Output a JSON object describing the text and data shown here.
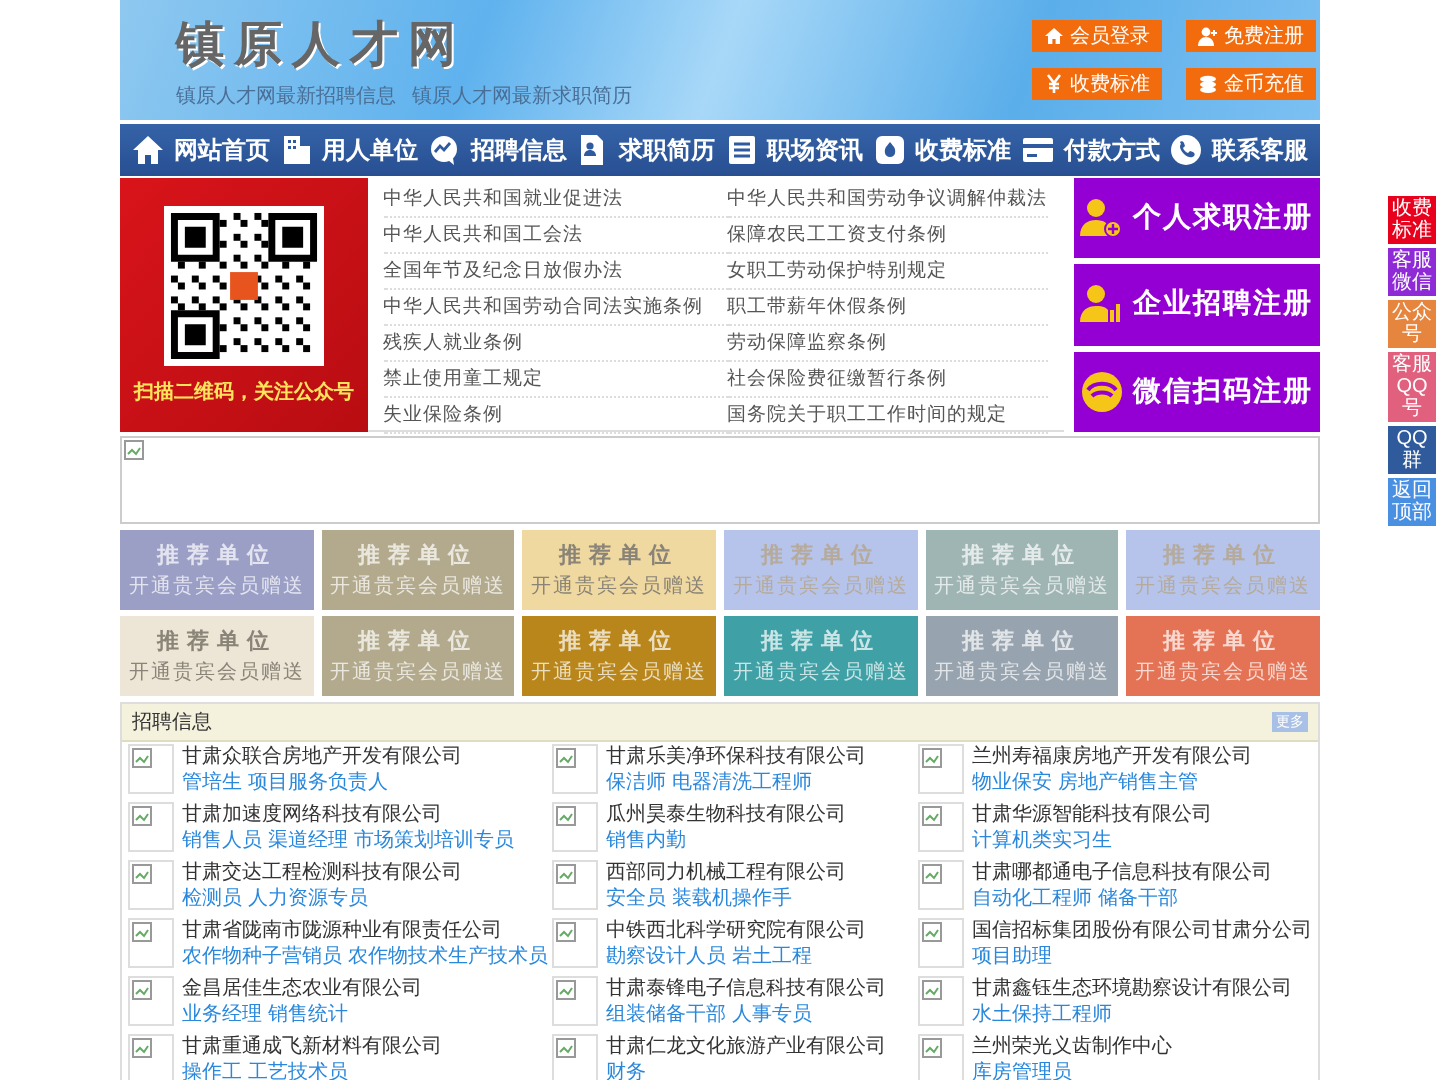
{
  "header": {
    "site_title": "镇原人才网",
    "taglines": [
      "镇原人才网最新招聘信息",
      "镇原人才网最新求职简历"
    ],
    "buttons": [
      "会员登录",
      "免费注册",
      "收费标准",
      "金币充值"
    ]
  },
  "nav": [
    "网站首页",
    "用人单位",
    "招聘信息",
    "求职简历",
    "职场资讯",
    "收费标准",
    "付款方式",
    "联系客服"
  ],
  "qr": {
    "caption": "扫描二维码，关注公众号"
  },
  "laws": [
    "中华人民共和国就业促进法",
    "中华人民共和国劳动争议调解仲裁法",
    "中华人民共和国工会法",
    "保障农民工工资支付条例",
    "全国年节及纪念日放假办法",
    "女职工劳动保护特别规定",
    "中华人民共和国劳动合同法实施条例",
    "职工带薪年休假条例",
    "残疾人就业条例",
    "劳动保障监察条例",
    "禁止使用童工规定",
    "社会保险费征缴暂行条例",
    "失业保险条例",
    "国务院关于职工工作时间的规定"
  ],
  "register_buttons": [
    "个人求职注册",
    "企业招聘注册",
    "微信扫码注册"
  ],
  "promo_tiles": [
    {
      "title": "推荐单位",
      "subtitle": "开通贵宾会员赠送",
      "color": "#9b9fc6"
    },
    {
      "title": "推荐单位",
      "subtitle": "开通贵宾会员赠送",
      "color": "#b3aa8e"
    },
    {
      "title": "推荐单位",
      "subtitle": "开通贵宾会员赠送",
      "color": "#f0d9a0"
    },
    {
      "title": "推荐单位",
      "subtitle": "开通贵宾会员赠送",
      "color": "#b6c4ec"
    },
    {
      "title": "推荐单位",
      "subtitle": "开通贵宾会员赠送",
      "color": "#9fb5b3"
    },
    {
      "title": "推荐单位",
      "subtitle": "开通贵宾会员赠送",
      "color": "#b6c4ec"
    },
    {
      "title": "推荐单位",
      "subtitle": "开通贵宾会员赠送",
      "color": "#ede6d6"
    },
    {
      "title": "推荐单位",
      "subtitle": "开通贵宾会员赠送",
      "color": "#b3aa8e"
    },
    {
      "title": "推荐单位",
      "subtitle": "开通贵宾会员赠送",
      "color": "#b8861b"
    },
    {
      "title": "推荐单位",
      "subtitle": "开通贵宾会员赠送",
      "color": "#3fa0a5"
    },
    {
      "title": "推荐单位",
      "subtitle": "开通贵宾会员赠送",
      "color": "#97a3ae"
    },
    {
      "title": "推荐单位",
      "subtitle": "开通贵宾会员赠送",
      "color": "#e47254"
    }
  ],
  "jobs": {
    "title": "招聘信息",
    "more": "更多",
    "listings": [
      {
        "company": "甘肃众联合房地产开发有限公司",
        "positions": [
          "管培生",
          "项目服务负责人"
        ]
      },
      {
        "company": "甘肃乐美净环保科技有限公司",
        "positions": [
          "保洁师",
          "电器清洗工程师"
        ]
      },
      {
        "company": "兰州寿福康房地产开发有限公司",
        "positions": [
          "物业保安",
          "房地产销售主管"
        ]
      },
      {
        "company": "甘肃加速度网络科技有限公司",
        "positions": [
          "销售人员",
          "渠道经理",
          "市场策划培训专员"
        ]
      },
      {
        "company": "瓜州昊泰生物科技有限公司",
        "positions": [
          "销售内勤"
        ]
      },
      {
        "company": "甘肃华源智能科技有限公司",
        "positions": [
          "计算机类实习生"
        ]
      },
      {
        "company": "甘肃交达工程检测科技有限公司",
        "positions": [
          "检测员",
          "人力资源专员"
        ]
      },
      {
        "company": "西部同力机械工程有限公司",
        "positions": [
          "安全员",
          "装载机操作手"
        ]
      },
      {
        "company": "甘肃哪都通电子信息科技有限公司",
        "positions": [
          "自动化工程师",
          "储备干部"
        ]
      },
      {
        "company": "甘肃省陇南市陇源种业有限责任公司",
        "positions": [
          "农作物种子营销员",
          "农作物技术生产技术员"
        ]
      },
      {
        "company": "中铁西北科学研究院有限公司",
        "positions": [
          "勘察设计人员",
          "岩土工程"
        ]
      },
      {
        "company": "国信招标集团股份有限公司甘肃分公司",
        "positions": [
          "项目助理"
        ]
      },
      {
        "company": "金昌居佳生态农业有限公司",
        "positions": [
          "业务经理",
          "销售统计"
        ]
      },
      {
        "company": "甘肃泰锋电子信息科技有限公司",
        "positions": [
          "组装储备干部",
          "人事专员"
        ]
      },
      {
        "company": "甘肃鑫钰生态环境勘察设计有限公司",
        "positions": [
          "水土保持工程师"
        ]
      },
      {
        "company": "甘肃重通成飞新材料有限公司",
        "positions": [
          "操作工",
          "工艺技术员"
        ]
      },
      {
        "company": "甘肃仁龙文化旅游产业有限公司",
        "positions": [
          "财务"
        ]
      },
      {
        "company": "兰州荣光义齿制作中心",
        "positions": [
          "库房管理员"
        ]
      }
    ]
  },
  "side_float": [
    {
      "label": "收费标准",
      "color": "#e8001c"
    },
    {
      "label": "客服微信",
      "color": "#8e2bd6"
    },
    {
      "label": "公众号",
      "color": "#e5853e"
    },
    {
      "label": "客服QQ号",
      "color": "#e0607e"
    },
    {
      "label": "QQ群",
      "color": "#2f5b9c"
    },
    {
      "label": "返回顶部",
      "color": "#4a90e2"
    }
  ]
}
